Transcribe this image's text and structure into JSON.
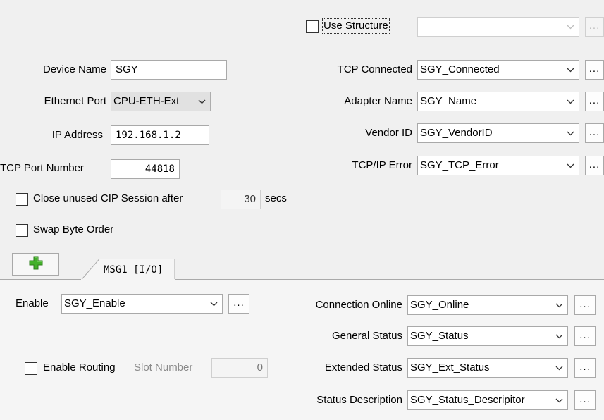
{
  "top": {
    "use_structure_label": "Use Structure",
    "use_structure_checked": false,
    "structure_combo_value": "",
    "structure_browse": "..."
  },
  "device": {
    "device_name_label": "Device Name",
    "device_name_value": "SGY",
    "ethernet_port_label": "Ethernet Port",
    "ethernet_port_value": "CPU-ETH-Ext",
    "ip_address_label": "IP Address",
    "ip_address_value": "192.168.1.2",
    "tcp_port_label": "TCP Port Number",
    "tcp_port_value": "44818",
    "close_unused_label": "Close unused CIP Session after",
    "close_unused_checked": false,
    "close_unused_value": "30",
    "close_unused_unit": "secs",
    "swap_byte_label": "Swap Byte Order",
    "swap_byte_checked": false
  },
  "tags": {
    "tcp_connected_label": "TCP Connected",
    "tcp_connected_value": "SGY_Connected",
    "adapter_name_label": "Adapter Name",
    "adapter_name_value": "SGY_Name",
    "vendor_id_label": "Vendor ID",
    "vendor_id_value": "SGY_VendorID",
    "tcp_error_label": "TCP/IP Error",
    "tcp_error_value": "SGY_TCP_Error",
    "browse": "..."
  },
  "tabs": {
    "add_icon": "plus-icon",
    "msg_tab_label": "MSG1 [I/O]"
  },
  "msg": {
    "enable_label": "Enable",
    "enable_value": "SGY_Enable",
    "enable_routing_label": "Enable Routing",
    "enable_routing_checked": false,
    "slot_number_label": "Slot Number",
    "slot_number_value": "0",
    "connection_online_label": "Connection Online",
    "connection_online_value": "SGY_Online",
    "general_status_label": "General Status",
    "general_status_value": "SGY_Status",
    "extended_status_label": "Extended Status",
    "extended_status_value": "SGY_Ext_Status",
    "status_description_label": "Status Description",
    "status_description_value": "SGY_Status_Descripitor",
    "browse": "..."
  },
  "colors": {
    "panel_bg": "#f0f0f0",
    "tab_panel_bg": "#f5f5f5",
    "plus_green": "#43b02a"
  }
}
